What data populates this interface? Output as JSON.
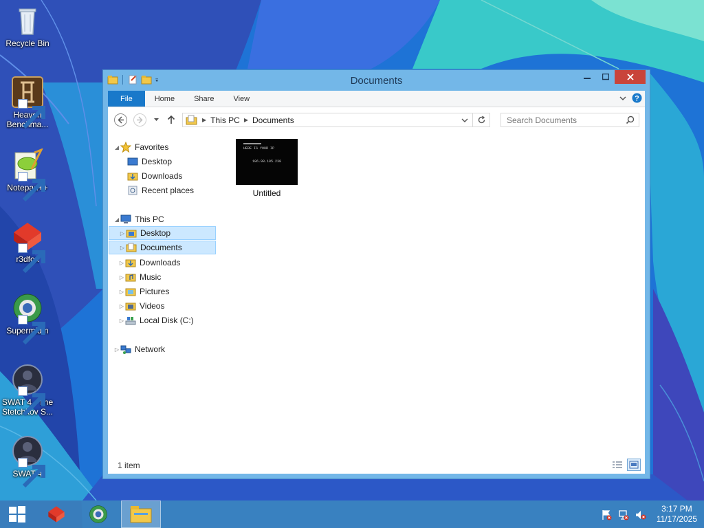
{
  "desktop": {
    "icons": [
      {
        "label": "Recycle Bin"
      },
      {
        "label": "Heaven Benchma..."
      },
      {
        "label": "Notepad++"
      },
      {
        "label": "r3dfox"
      },
      {
        "label": "Supermium"
      },
      {
        "label": "SWAT 4 - The Stetchkov S..."
      },
      {
        "label": "SWAT 4"
      }
    ]
  },
  "window": {
    "title": "Documents",
    "ribbon": {
      "tabs": [
        "File",
        "Home",
        "Share",
        "View"
      ]
    },
    "address": {
      "crumbs": [
        "This PC",
        "Documents"
      ]
    },
    "search": {
      "placeholder": "Search Documents"
    },
    "nav": {
      "favorites": {
        "label": "Favorites",
        "items": [
          "Desktop",
          "Downloads",
          "Recent places"
        ]
      },
      "this_pc": {
        "label": "This PC",
        "items": [
          "Desktop",
          "Documents",
          "Downloads",
          "Music",
          "Pictures",
          "Videos",
          "Local Disk (C:)"
        ]
      },
      "network": {
        "label": "Network"
      }
    },
    "files": [
      {
        "name": "Untitled",
        "thumbnail_lines": [
          "HERE IS YOUR IP",
          "186.98.195.230"
        ]
      }
    ],
    "status": {
      "item_count": "1 item"
    }
  },
  "taskbar": {
    "clock": {
      "time": "3:17 PM",
      "date": "11/17/2025"
    }
  },
  "colors": {
    "accent": "#1979ca",
    "selection": "#cce8ff",
    "close": "#c9443a",
    "taskbar": "#3c82be"
  }
}
